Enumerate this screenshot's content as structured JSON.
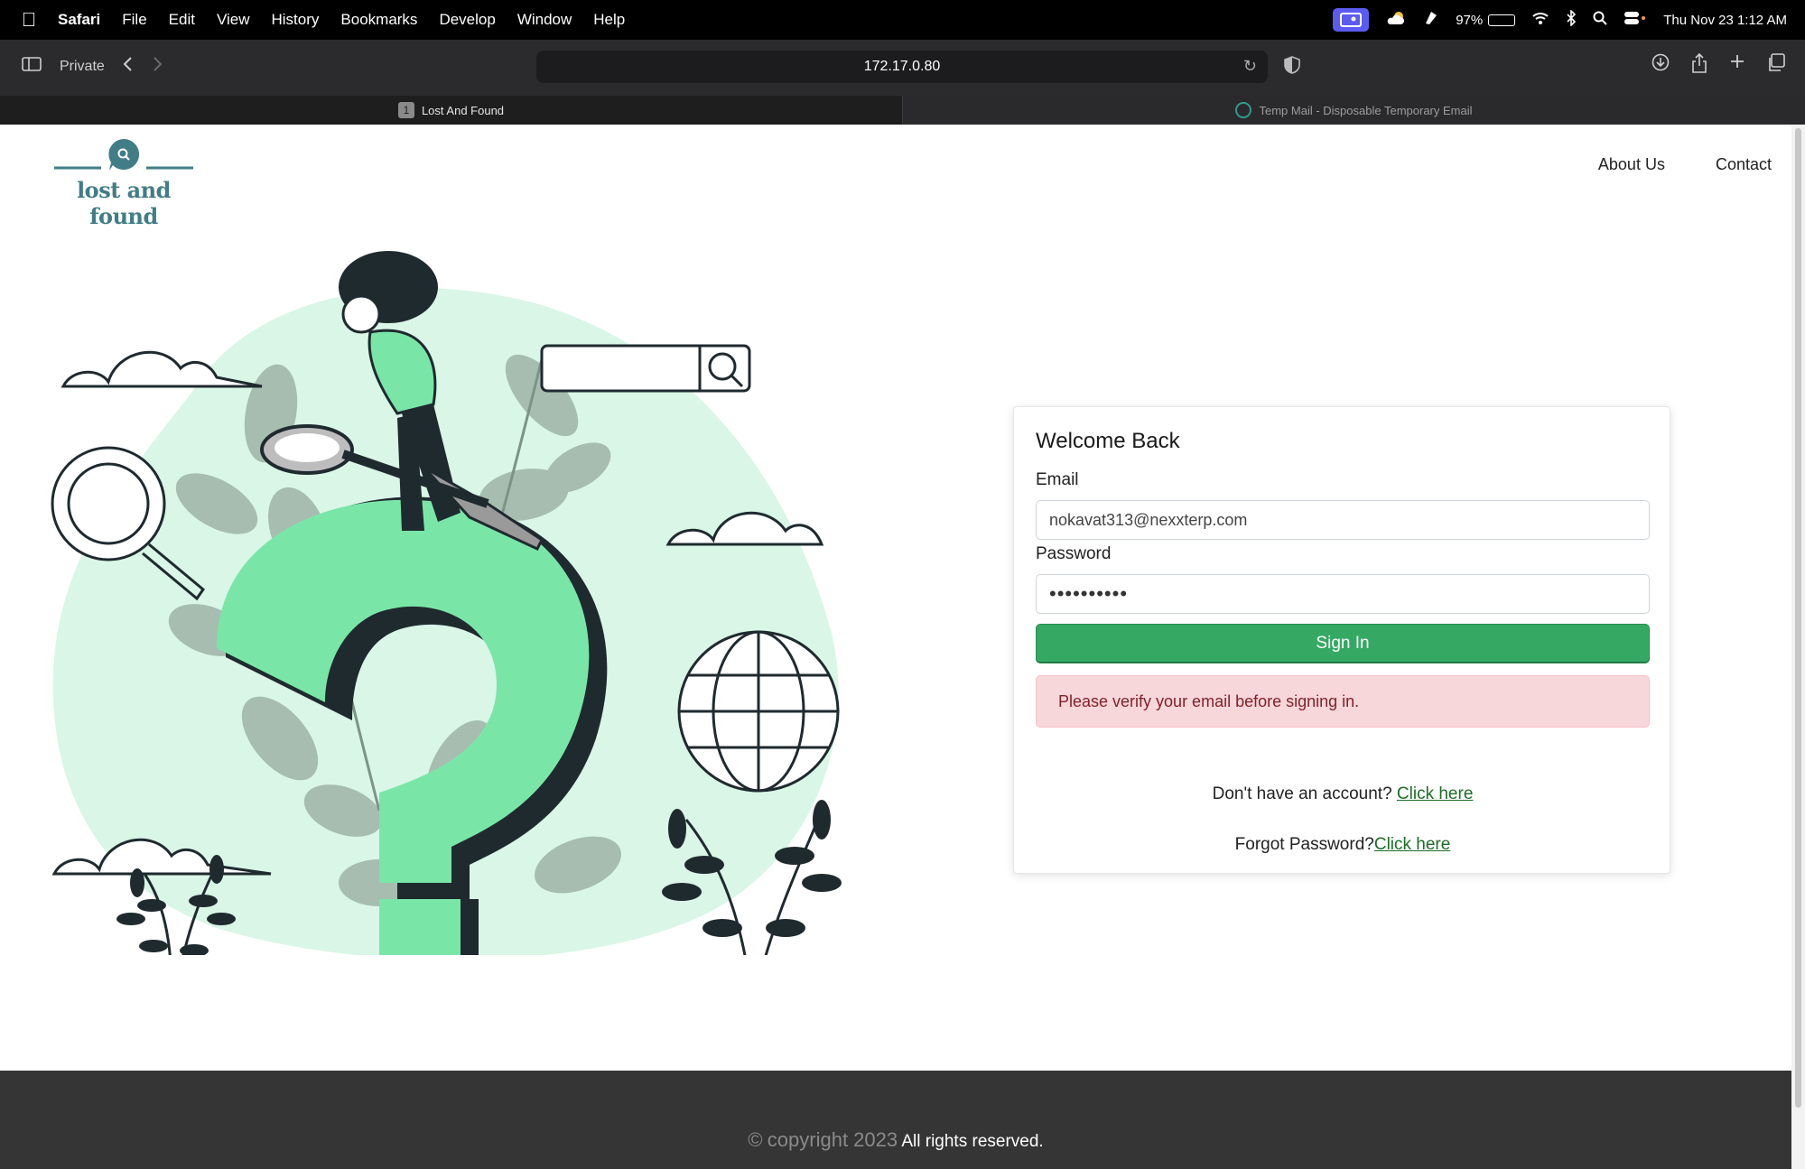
{
  "menubar": {
    "apple": "",
    "app": "Safari",
    "items": [
      "File",
      "Edit",
      "View",
      "History",
      "Bookmarks",
      "Develop",
      "Window",
      "Help"
    ],
    "battery": "97%",
    "battery_level": 0.97,
    "datetime": "Thu Nov 23  1:12 AM"
  },
  "toolbar": {
    "private_label": "Private",
    "url": "172.17.0.80"
  },
  "tabs": [
    {
      "badge": "1",
      "title": "Lost And Found",
      "active": true
    },
    {
      "title": "Temp Mail - Disposable Temporary Email",
      "active": false
    }
  ],
  "site": {
    "logo_text": "lost and found",
    "nav": [
      "About Us",
      "Contact"
    ]
  },
  "login": {
    "heading": "Welcome Back",
    "email_label": "Email",
    "email_value": "nokavat313@nexxterp.com",
    "password_label": "Password",
    "password_value": "••••••••••",
    "signin_label": "Sign In",
    "alert": "Please verify your email before signing in.",
    "signup_prompt": "Don't have an account? ",
    "signup_link": "Click here",
    "forgot_prompt": "Forgot Password?",
    "forgot_link": "Click here"
  },
  "footer": {
    "copyright_symbol": "©",
    "copyright": "copyright 2023",
    "rights": "All rights reserved."
  },
  "colors": {
    "accent_green": "#35a963",
    "illustration_mint": "#d9f6e6",
    "question_green": "#79e6a8",
    "logo_teal": "#417d86"
  }
}
